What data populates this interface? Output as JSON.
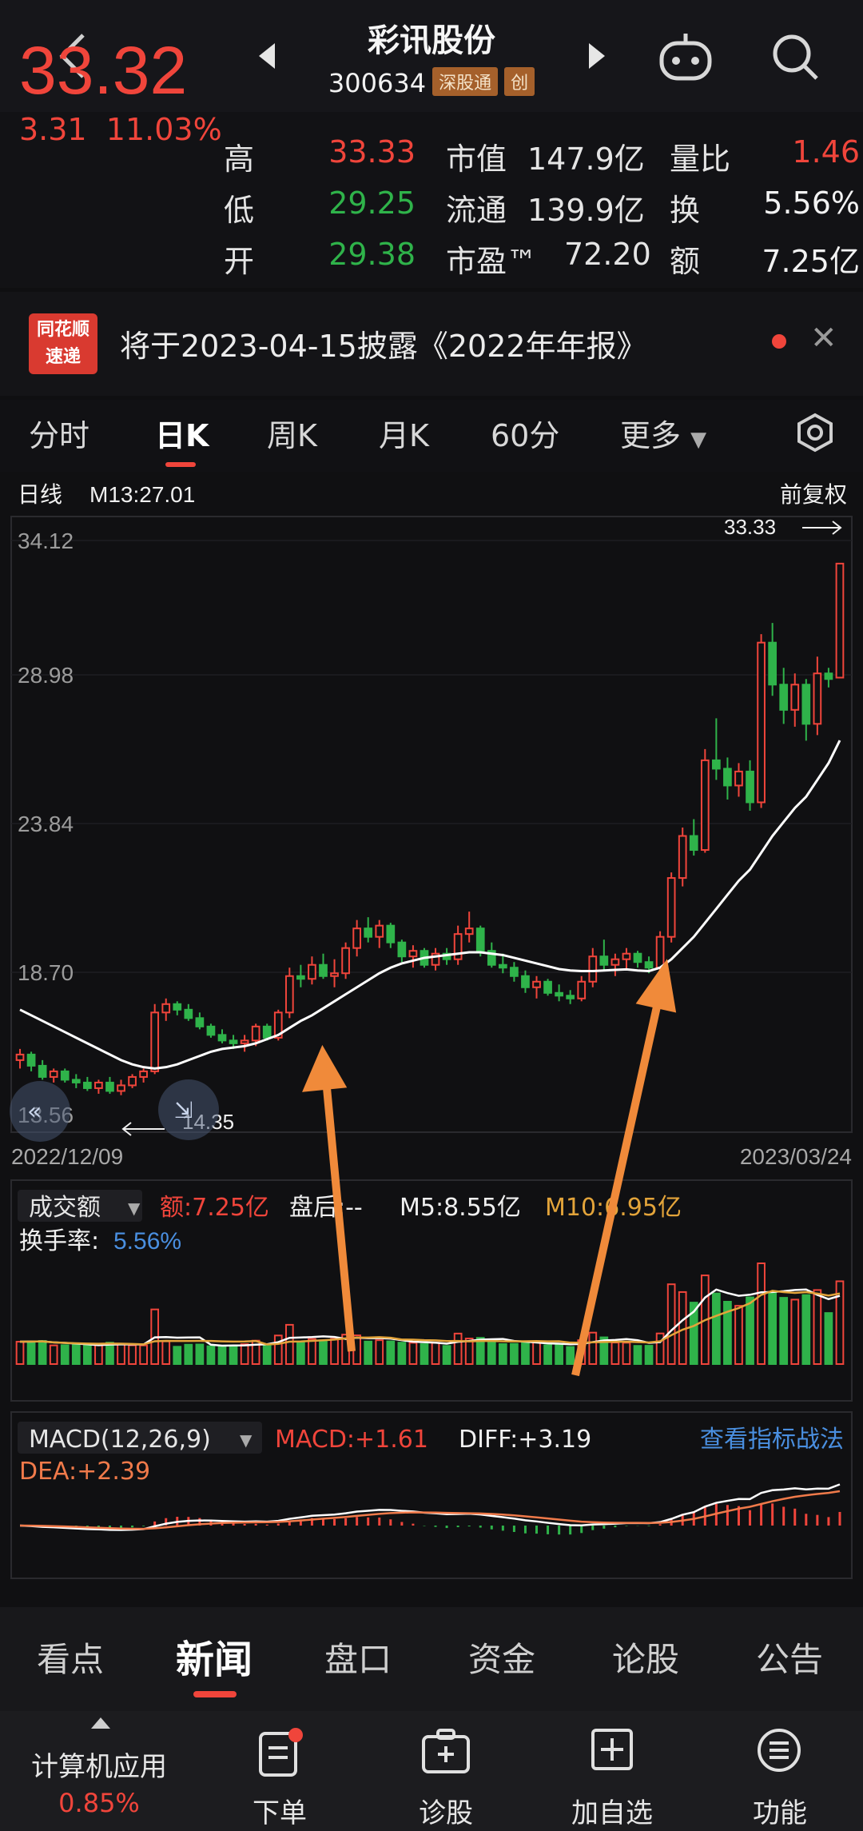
{
  "header": {
    "title": "彩讯股份",
    "code": "300634",
    "tag1": "深股通",
    "tag2": "创"
  },
  "quote": {
    "price": "33.32",
    "change": "3.31",
    "change_pct": "11.03%",
    "rows": [
      {
        "l1": "高",
        "v1": "33.33",
        "c1": "red",
        "l2": "市值",
        "v2": "147.9亿",
        "l3": "量比",
        "v3": "1.46",
        "c3": "red"
      },
      {
        "l1": "低",
        "v1": "29.25",
        "c1": "green",
        "l2": "流通",
        "v2": "139.9亿",
        "l3": "换",
        "v3": "5.56%",
        "c3": "white"
      },
      {
        "l1": "开",
        "v1": "29.38",
        "c1": "green",
        "l2": "市盈™",
        "v2": "72.20",
        "l3": "额",
        "v3": "7.25亿",
        "c3": "white"
      }
    ]
  },
  "ticker": {
    "logo_top": "同花顺",
    "logo_bottom": "速递",
    "text": "将于2023-04-15披露《2022年年报》"
  },
  "period_tabs": [
    "分时",
    "日K",
    "周K",
    "月K",
    "60分",
    "更多"
  ],
  "chart": {
    "line_label": "日线",
    "ma_label": "M13:27.01",
    "adjust": "前复权",
    "y_ticks": [
      "34.12",
      "28.98",
      "23.84",
      "18.70",
      "13.56"
    ],
    "high_mark": "33.33",
    "low_mark": "14.35",
    "date_start": "2022/12/09",
    "date_end": "2023/03/24",
    "ohlc": [
      [
        15.6,
        16.0,
        15.3,
        15.8
      ],
      [
        15.8,
        15.9,
        15.2,
        15.4
      ],
      [
        15.4,
        15.6,
        14.9,
        15.0
      ],
      [
        15.0,
        15.3,
        14.8,
        15.2
      ],
      [
        15.2,
        15.3,
        14.8,
        14.9
      ],
      [
        14.9,
        15.1,
        14.6,
        14.8
      ],
      [
        14.8,
        15.0,
        14.5,
        14.6
      ],
      [
        14.6,
        14.9,
        14.4,
        14.8
      ],
      [
        14.8,
        15.0,
        14.4,
        14.5
      ],
      [
        14.5,
        14.9,
        14.35,
        14.7
      ],
      [
        14.7,
        15.1,
        14.6,
        15.0
      ],
      [
        15.0,
        15.3,
        14.8,
        15.2
      ],
      [
        15.2,
        17.6,
        15.1,
        17.3
      ],
      [
        17.3,
        17.8,
        17.0,
        17.6
      ],
      [
        17.6,
        17.7,
        17.2,
        17.4
      ],
      [
        17.4,
        17.6,
        17.0,
        17.1
      ],
      [
        17.1,
        17.3,
        16.7,
        16.8
      ],
      [
        16.8,
        16.9,
        16.4,
        16.5
      ],
      [
        16.5,
        16.7,
        16.2,
        16.3
      ],
      [
        16.3,
        16.5,
        16.0,
        16.2
      ],
      [
        16.2,
        16.5,
        15.9,
        16.3
      ],
      [
        16.3,
        16.9,
        16.1,
        16.8
      ],
      [
        16.8,
        16.9,
        16.3,
        16.4
      ],
      [
        16.4,
        17.4,
        16.3,
        17.3
      ],
      [
        17.3,
        18.9,
        17.1,
        18.6
      ],
      [
        18.6,
        19.0,
        18.2,
        18.5
      ],
      [
        18.5,
        19.3,
        18.3,
        19.0
      ],
      [
        19.0,
        19.4,
        18.5,
        18.6
      ],
      [
        18.6,
        19.2,
        18.2,
        18.7
      ],
      [
        18.7,
        19.8,
        18.5,
        19.6
      ],
      [
        19.6,
        20.6,
        19.3,
        20.3
      ],
      [
        20.3,
        20.7,
        19.8,
        20.0
      ],
      [
        20.0,
        20.6,
        19.6,
        20.4
      ],
      [
        20.4,
        20.5,
        19.6,
        19.8
      ],
      [
        19.8,
        19.9,
        19.1,
        19.3
      ],
      [
        19.3,
        19.7,
        18.9,
        19.5
      ],
      [
        19.5,
        19.6,
        18.9,
        19.0
      ],
      [
        19.0,
        19.6,
        18.8,
        19.4
      ],
      [
        19.4,
        19.6,
        19.0,
        19.2
      ],
      [
        19.2,
        20.4,
        19.0,
        20.1
      ],
      [
        20.1,
        20.9,
        19.8,
        20.3
      ],
      [
        20.3,
        20.4,
        19.3,
        19.5
      ],
      [
        19.5,
        19.8,
        18.9,
        19.0
      ],
      [
        19.0,
        19.4,
        18.7,
        18.9
      ],
      [
        18.9,
        19.1,
        18.4,
        18.6
      ],
      [
        18.6,
        18.8,
        18.0,
        18.2
      ],
      [
        18.2,
        18.6,
        17.8,
        18.4
      ],
      [
        18.4,
        18.5,
        17.9,
        18.0
      ],
      [
        18.0,
        18.3,
        17.7,
        17.9
      ],
      [
        17.9,
        18.1,
        17.6,
        17.8
      ],
      [
        17.8,
        18.6,
        17.7,
        18.4
      ],
      [
        18.4,
        19.6,
        18.2,
        19.3
      ],
      [
        19.3,
        19.9,
        18.8,
        19.0
      ],
      [
        19.0,
        19.4,
        18.6,
        19.2
      ],
      [
        19.2,
        19.6,
        18.8,
        19.4
      ],
      [
        19.4,
        19.5,
        18.9,
        19.1
      ],
      [
        19.1,
        19.3,
        18.7,
        18.9
      ],
      [
        18.9,
        20.2,
        18.8,
        20.0
      ],
      [
        20.0,
        22.3,
        19.8,
        22.1
      ],
      [
        22.1,
        23.9,
        21.8,
        23.6
      ],
      [
        23.6,
        24.2,
        22.9,
        23.1
      ],
      [
        23.1,
        26.7,
        23.0,
        26.3
      ],
      [
        26.3,
        27.8,
        25.6,
        26.0
      ],
      [
        26.0,
        26.4,
        24.9,
        25.4
      ],
      [
        25.4,
        26.2,
        25.0,
        25.9
      ],
      [
        25.9,
        26.3,
        24.5,
        24.8
      ],
      [
        24.8,
        30.8,
        24.6,
        30.5
      ],
      [
        30.5,
        31.2,
        28.6,
        29.0
      ],
      [
        29.0,
        29.6,
        27.6,
        28.1
      ],
      [
        28.1,
        29.4,
        27.5,
        29.0
      ],
      [
        29.0,
        29.2,
        27.0,
        27.6
      ],
      [
        27.6,
        30.0,
        27.2,
        29.4
      ],
      [
        29.4,
        29.6,
        28.9,
        29.2
      ],
      [
        29.25,
        33.33,
        29.25,
        33.32
      ]
    ],
    "ma": [
      17.4,
      17.2,
      17.0,
      16.8,
      16.6,
      16.4,
      16.2,
      16.0,
      15.8,
      15.6,
      15.45,
      15.35,
      15.3,
      15.35,
      15.45,
      15.6,
      15.75,
      15.9,
      16.0,
      16.05,
      16.1,
      16.2,
      16.35,
      16.5,
      16.75,
      17.0,
      17.2,
      17.45,
      17.7,
      17.95,
      18.2,
      18.45,
      18.7,
      18.9,
      19.05,
      19.15,
      19.25,
      19.3,
      19.35,
      19.4,
      19.45,
      19.45,
      19.4,
      19.35,
      19.25,
      19.15,
      19.05,
      18.95,
      18.85,
      18.8,
      18.78,
      18.78,
      18.8,
      18.82,
      18.84,
      18.8,
      18.78,
      18.9,
      19.2,
      19.6,
      20.0,
      20.5,
      21.0,
      21.5,
      22.0,
      22.4,
      23.0,
      23.6,
      24.1,
      24.6,
      25.0,
      25.6,
      26.2,
      27.01
    ]
  },
  "volume": {
    "selector": "成交额",
    "amount": "额:7.25亿",
    "pan": "盘后:--",
    "m5": "M5:8.55亿",
    "m10": "M10:6.95亿",
    "turnover_label": "换手率:",
    "turnover": "5.56%"
  },
  "macd": {
    "selector": "MACD(12,26,9)",
    "macd": "MACD:+1.61",
    "diff": "DIFF:+3.19",
    "link": "查看指标战法",
    "dea": "DEA:+2.39"
  },
  "bottom_tabs": [
    "看点",
    "新闻",
    "盘口",
    "资金",
    "论股",
    "公告"
  ],
  "bottom_bar": {
    "sector": "计算机应用",
    "sector_pct": "0.85%",
    "items": [
      "下单",
      "诊股",
      "加自选",
      "功能"
    ]
  },
  "colors": {
    "up": "#f0453b",
    "down": "#2fb34a",
    "ma": "#ffffff",
    "m10": "#e3a43a",
    "link": "#4a8fe0",
    "arrow": "#f08a3a"
  }
}
